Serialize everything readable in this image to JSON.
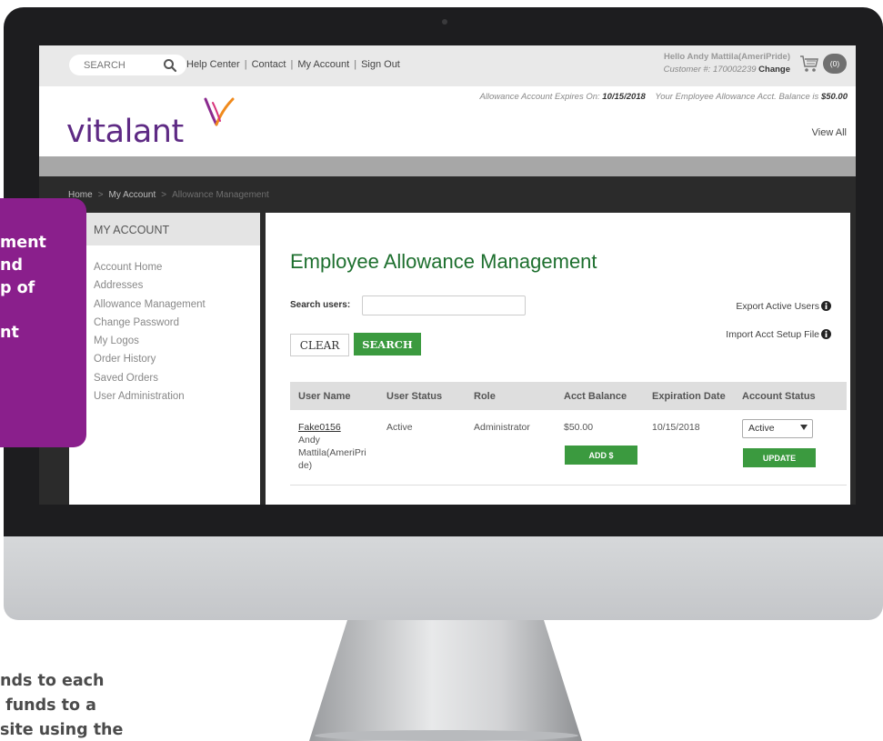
{
  "topbar": {
    "search_placeholder": "SEARCH",
    "links": [
      "Help Center",
      "Contact",
      "My Account",
      "Sign Out"
    ],
    "hello": "Hello Andy Mattila(AmeriPride)",
    "customer": "Customer #: 170002239",
    "change": "Change",
    "cart_count": "(0)"
  },
  "header": {
    "logo": "vitalant",
    "expiry_label": "Allowance Account Expires On:",
    "expiry_date": "10/15/2018",
    "balance_label": "Your Employee Allowance Acct. Balance is",
    "balance_value": "$50.00",
    "view_all": "View All"
  },
  "breadcrumb": [
    "Home",
    "My Account",
    "Allowance Management"
  ],
  "sidebar": {
    "title": "MY ACCOUNT",
    "items": [
      "Account Home",
      "Addresses",
      "Allowance Management",
      "Change Password",
      "My Logos",
      "Order History",
      "Saved Orders",
      "User Administration"
    ]
  },
  "main": {
    "title": "Employee Allowance Management",
    "search_label": "Search users:",
    "search_value": "",
    "export": "Export Active Users",
    "import": "Import Acct Setup File",
    "clear": "CLEAR",
    "search": "SEARCH",
    "columns": [
      "User Name",
      "User Status",
      "Role",
      "Acct Balance",
      "Expiration Date",
      "Account Status"
    ],
    "row": {
      "user_id": "Fake0156",
      "user_name_l1": "Andy",
      "user_name_l2": "Mattila(AmeriPri",
      "user_name_l3": "de)",
      "status": "Active",
      "role": "Administrator",
      "balance": "$50.00",
      "expiration": "10/15/2018",
      "account_status": "Active",
      "add_label": "ADD $",
      "update_label": "UPDATE"
    }
  },
  "callout": {
    "lines": "ment\nnd\np of\n\nnt"
  },
  "bottom_text": "nds to each\n funds to a\nsite using the",
  "colors": {
    "brand": "#5e2a84",
    "accent": "#3b9a3f",
    "callout": "#8a1f8c",
    "title": "#1d6f2e"
  }
}
